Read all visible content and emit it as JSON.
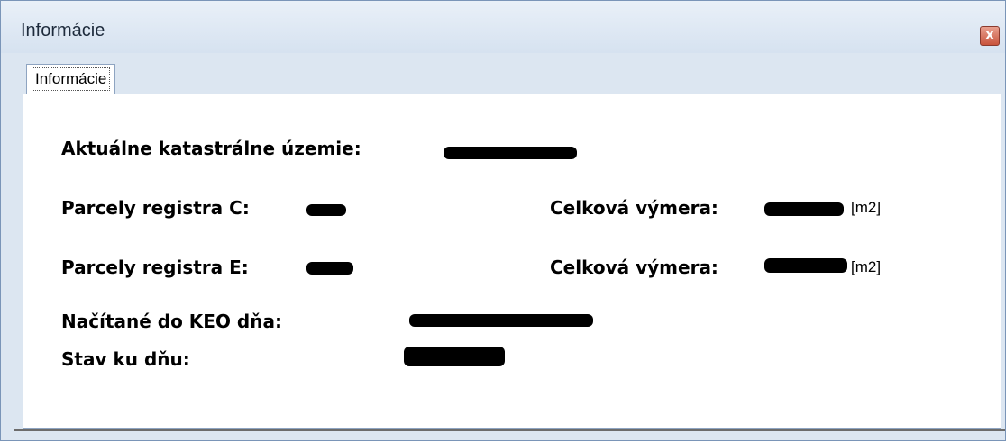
{
  "window": {
    "title": "Informácie",
    "close_glyph": "x"
  },
  "tabs": [
    {
      "label": "Informácie",
      "active": true
    }
  ],
  "info": {
    "katastralne_uzemie_label": "Aktuálne katastrálne územie:",
    "parcely_c_label": "Parcely registra C:",
    "parcely_e_label": "Parcely registra E:",
    "vymera_c_label": "Celková výmera:",
    "vymera_e_label": "Celková výmera:",
    "unit_c": "[m2]",
    "unit_e": "[m2]",
    "nacitane_label": "Načítané do KEO dňa:",
    "stav_label": "Stav ku dňu:"
  },
  "colors": {
    "window_frame": "#dce6f1",
    "close_button": "#c8533c",
    "redaction": "#000000"
  },
  "redacted_values": "value fields obscured with black marker"
}
